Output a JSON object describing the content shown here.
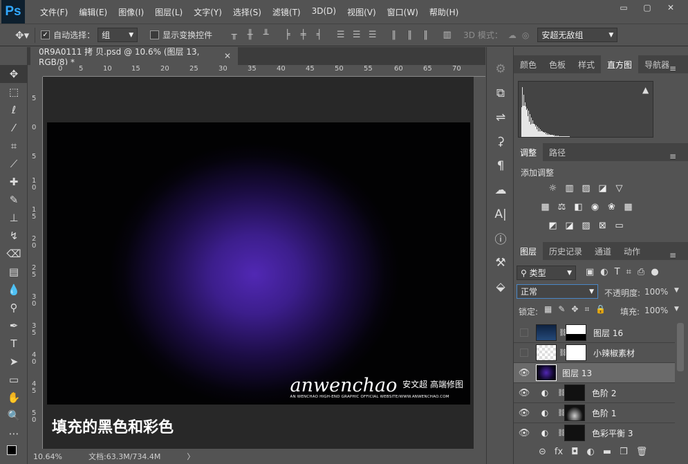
{
  "app": {
    "logo": "Ps"
  },
  "menu": [
    "文件(F)",
    "编辑(E)",
    "图像(I)",
    "图层(L)",
    "文字(Y)",
    "选择(S)",
    "滤镜(T)",
    "3D(D)",
    "视图(V)",
    "窗口(W)",
    "帮助(H)"
  ],
  "window_controls": {
    "minimize": "▭",
    "restore": "▢",
    "close": "✕"
  },
  "options": {
    "auto_select_label": "自动选择：",
    "auto_select_value": "组",
    "show_transform_label": "显示变换控件",
    "mode_3d_label": "3D 模式：",
    "workspace": "安超无敌组"
  },
  "document": {
    "tab_title": "0R9A0111 拷 贝.psd @ 10.6% (图层 13, RGB/8) *",
    "ruler_h": [
      "0",
      "5",
      "10",
      "15",
      "20",
      "25",
      "30",
      "35",
      "40",
      "45",
      "50",
      "55",
      "60",
      "65",
      "70"
    ],
    "ruler_v": [
      "5",
      "0",
      "5",
      "1\n0",
      "1\n5",
      "2\n0",
      "2\n5",
      "3\n0",
      "3\n5",
      "4\n0",
      "4\n5",
      "5\n0"
    ],
    "zoom": "10.64%",
    "doc_info": "文档:63.3M/734.4M",
    "status_arrow": "〉"
  },
  "artwork": {
    "brand_main": "anwenchao",
    "brand_cn": "安文超 高端修图",
    "brand_small": "AN WENCHAO HIGH-END GRAPHIC OFFICIAL WEBSITE/WWW.ANWENCHAO.COM",
    "caption": "填充的黑色和彩色"
  },
  "panels": {
    "top_tabs": [
      "颜色",
      "色板",
      "样式",
      "直方图",
      "导航器"
    ],
    "top_active": "直方图",
    "histogram_warning": "▲",
    "adj_tabs": [
      "调整",
      "路径"
    ],
    "adj_title": "添加调整",
    "layers_tabs": [
      "图层",
      "历史记录",
      "通道",
      "动作"
    ],
    "filter_kind": "类型",
    "blend_mode": "正常",
    "opacity_label": "不透明度:",
    "opacity_value": "100%",
    "lock_label": "锁定:",
    "fill_label": "填充:",
    "fill_value": "100%",
    "layers": [
      {
        "name": "图层 16",
        "visible": false,
        "type": "mask"
      },
      {
        "name": "小辣椒素材",
        "visible": false,
        "type": "mask"
      },
      {
        "name": "图层 13",
        "visible": true,
        "type": "pixel",
        "selected": true
      },
      {
        "name": "色阶 2",
        "visible": true,
        "type": "adjust"
      },
      {
        "name": "色阶 1",
        "visible": true,
        "type": "adjust"
      },
      {
        "name": "色彩平衡 3",
        "visible": true,
        "type": "adjust"
      }
    ],
    "layer_footer": [
      "⊝",
      "fx",
      "◘",
      "◐",
      "▬",
      "❒",
      "🗑"
    ]
  },
  "colors": {
    "ui_bg": "#535353",
    "accent_purple": "#5128b4",
    "selected_layer": "#6a6a6a"
  }
}
